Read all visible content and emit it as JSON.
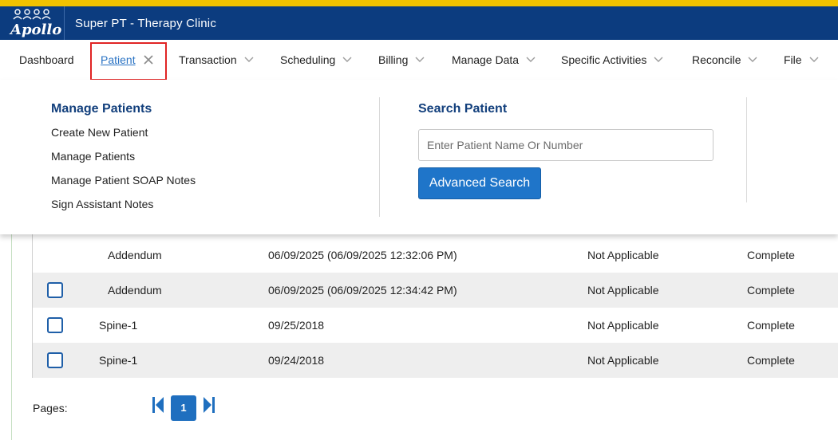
{
  "header": {
    "logo_text": "Apollo",
    "app_title": "Super PT - Therapy Clinic"
  },
  "nav": {
    "items": [
      {
        "label": "Dashboard"
      },
      {
        "label": "Patient"
      },
      {
        "label": "Transaction"
      },
      {
        "label": "Scheduling"
      },
      {
        "label": "Billing"
      },
      {
        "label": "Manage Data"
      },
      {
        "label": "Specific Activities"
      },
      {
        "label": "Reconcile"
      },
      {
        "label": "File"
      }
    ]
  },
  "mega_menu": {
    "manage_patients": {
      "title": "Manage Patients",
      "links": [
        "Create New Patient",
        "Manage Patients",
        "Manage Patient SOAP Notes",
        "Sign Assistant Notes"
      ]
    },
    "search_patient": {
      "title": "Search Patient",
      "placeholder": "Enter Patient Name Or Number",
      "button_label": "Advanced Search"
    }
  },
  "table": {
    "rows": [
      {
        "name": "Addendum",
        "date": "06/09/2025 (06/09/2025 12:32:06 PM)",
        "applicability": "Not Applicable",
        "status": "Complete",
        "has_checkbox": false
      },
      {
        "name": "Addendum",
        "date": "06/09/2025 (06/09/2025 12:34:42 PM)",
        "applicability": "Not Applicable",
        "status": "Complete",
        "has_checkbox": true
      },
      {
        "name": "Spine-1",
        "date": "09/25/2018",
        "applicability": "Not Applicable",
        "status": "Complete",
        "has_checkbox": true
      },
      {
        "name": "Spine-1",
        "date": "09/24/2018",
        "applicability": "Not Applicable",
        "status": "Complete",
        "has_checkbox": true
      }
    ]
  },
  "pager": {
    "label": "Pages:",
    "current_page": "1"
  },
  "colors": {
    "header_bg": "#0c3c7f",
    "top_stripe": "#f2c200",
    "accent": "#1f75c9",
    "highlight_box": "#e02424"
  }
}
